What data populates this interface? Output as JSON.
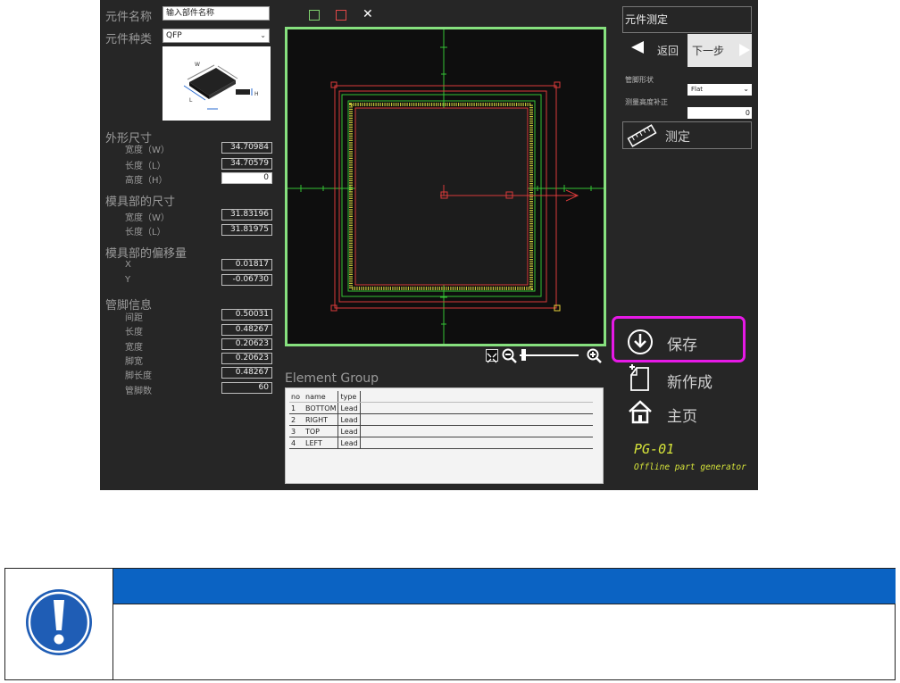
{
  "app": {
    "part_name_label": "元件名称",
    "part_name_placeholder": "输入部件名称",
    "part_type_label": "元件种类",
    "part_type_value": "QFP",
    "outline_section": "外形尺寸",
    "outline": [
      {
        "label": "宽度（W）",
        "value": "34.70984"
      },
      {
        "label": "长度（L）",
        "value": "34.70579"
      },
      {
        "label": "高度（H）",
        "value": "0"
      }
    ],
    "mold_section": "模具部的尺寸",
    "mold": [
      {
        "label": "宽度（W）",
        "value": "31.83196"
      },
      {
        "label": "长度（L）",
        "value": "31.81975"
      }
    ],
    "offset_section": "模具部的偏移量",
    "offset": [
      {
        "label": "X",
        "value": "0.01817"
      },
      {
        "label": "Y",
        "value": "-0.06730"
      }
    ],
    "lead_section": "管脚信息",
    "lead": [
      {
        "label": "间距",
        "value": "0.50031"
      },
      {
        "label": "长度",
        "value": "0.48267"
      },
      {
        "label": "宽度",
        "value": "0.20623"
      },
      {
        "label": "脚宽",
        "value": "0.20623"
      },
      {
        "label": "脚长度",
        "value": "0.48267"
      },
      {
        "label": "管脚数",
        "value": "60"
      }
    ],
    "chip_dim_labels": {
      "w": "W",
      "l": "L",
      "h": "H"
    }
  },
  "viewport": {
    "toolbar": {
      "green_square": "□",
      "red_square": "□",
      "close": "✕"
    }
  },
  "element_group": {
    "title": "Element Group",
    "columns": [
      "no",
      "name",
      "type"
    ],
    "rows": [
      {
        "no": "1",
        "name": "BOTTOM",
        "type": "Lead"
      },
      {
        "no": "2",
        "name": "RIGHT",
        "type": "Lead"
      },
      {
        "no": "3",
        "name": "TOP",
        "type": "Lead"
      },
      {
        "no": "4",
        "name": "LEFT",
        "type": "Lead"
      }
    ]
  },
  "right_panel": {
    "measure_part_button": "元件测定",
    "back_label": "返回",
    "next_label": "下一步",
    "lead_shape_label": "管脚形状",
    "lead_shape_value": "Flat",
    "height_correction_label": "测量高度补正",
    "height_correction_value": "0",
    "measure_label": "测定",
    "save_label": "保存",
    "new_label": "新作成",
    "home_label": "主页",
    "pg_title": "PG-01",
    "pg_subtitle": "Offline part generator"
  },
  "notice": {
    "header": "",
    "body": ""
  },
  "colors": {
    "app_bg": "#262626",
    "viewport_border": "#86e07e",
    "accent_yellow": "#d7e53a",
    "highlight_magenta": "#e619e6",
    "notice_blue": "#0b63c3"
  }
}
